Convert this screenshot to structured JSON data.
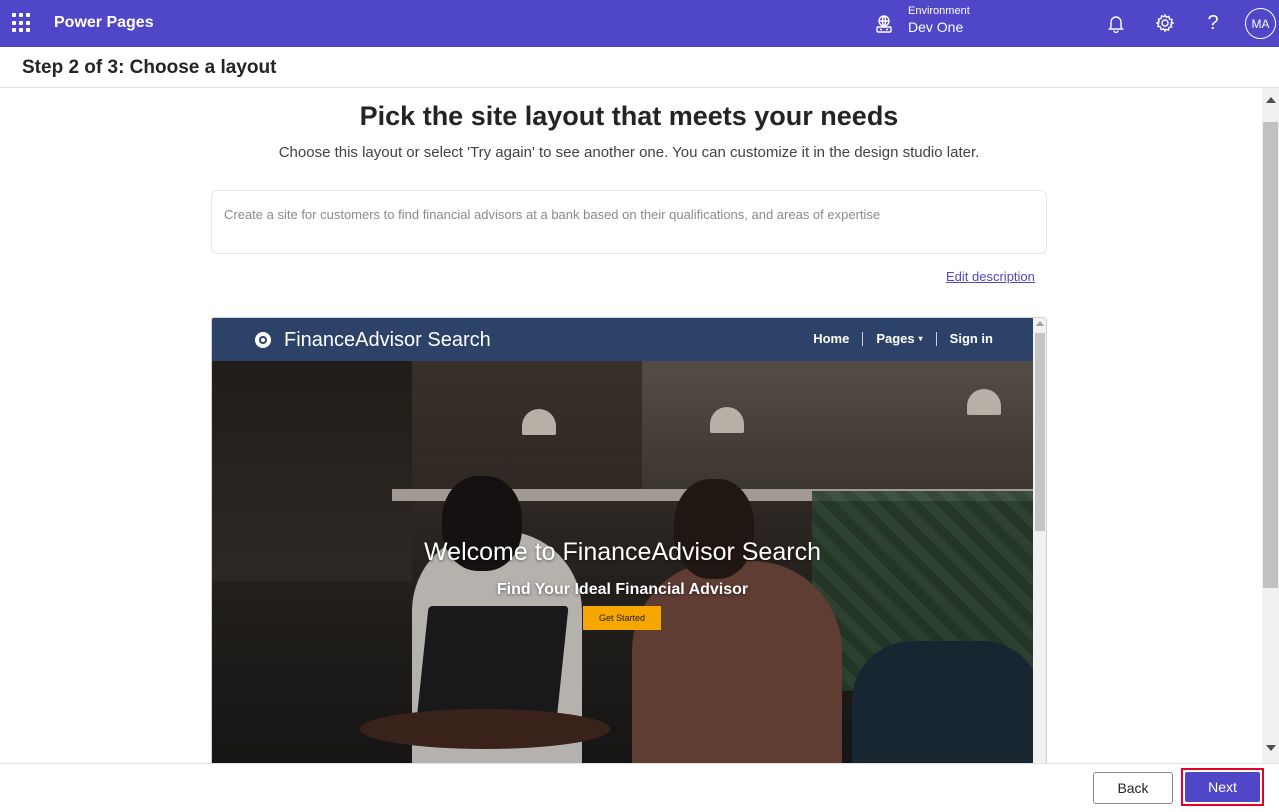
{
  "topbar": {
    "app_title": "Power Pages",
    "environment_label": "Environment",
    "environment_name": "Dev One",
    "help_glyph": "?",
    "avatar_initials": "MA",
    "icons": [
      "waffle-icon",
      "environment-icon",
      "bell-icon",
      "gear-icon",
      "help-icon"
    ]
  },
  "step": {
    "title": "Step 2 of 3: Choose a layout"
  },
  "main": {
    "headline": "Pick the site layout that meets your needs",
    "subline": "Choose this layout or select 'Try again' to see another one. You can customize it in the design studio later.",
    "description": "Create a site for customers to find financial advisors at a bank based on their qualifications, and areas of expertise",
    "edit_link": "Edit description"
  },
  "preview": {
    "brand": "FinanceAdvisor Search",
    "nav": {
      "home": "Home",
      "pages": "Pages",
      "sign_in": "Sign in"
    },
    "hero_title": "Welcome to FinanceAdvisor Search",
    "hero_tagline": "Find Your Ideal Financial Advisor",
    "cta_label": "Get Started",
    "colors": {
      "nav_bg": "#2c4268",
      "cta_bg": "#f6a600"
    }
  },
  "footer": {
    "back_label": "Back",
    "next_label": "Next"
  },
  "colors": {
    "brand": "#4f46c8",
    "highlight": "#e3002b"
  }
}
